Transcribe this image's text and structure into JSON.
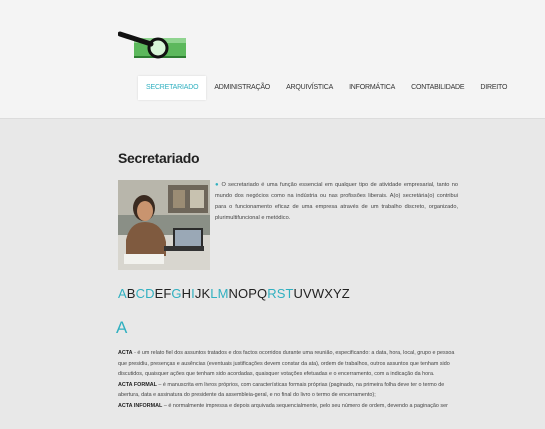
{
  "nav": {
    "items": [
      {
        "label": "SECRETARIADO",
        "active": true
      },
      {
        "label": "ADMINISTRAÇÃO",
        "active": false
      },
      {
        "label": "ARQUIVÍSTICA",
        "active": false
      },
      {
        "label": "INFORMÁTICA",
        "active": false
      },
      {
        "label": "CONTABILIDADE",
        "active": false
      },
      {
        "label": "DIREITO",
        "active": false
      }
    ]
  },
  "main": {
    "title": "Secretariado",
    "intro_text": "O secretariado é uma função essencial em qualquer tipo de atividade empresarial, tanto no mundo dos negócios como na indústria ou nas profissões liberais. A(o) secretária(o) contribui para o funcionamento eficaz de uma empresa através de um trabalho discreto, organizado, plurimultifuncional e metódico."
  },
  "alphabet": [
    {
      "letter": "A",
      "highlight": true
    },
    {
      "letter": "B",
      "highlight": false
    },
    {
      "letter": "C",
      "highlight": true
    },
    {
      "letter": "D",
      "highlight": true
    },
    {
      "letter": "E",
      "highlight": false
    },
    {
      "letter": "F",
      "highlight": false
    },
    {
      "letter": "G",
      "highlight": true
    },
    {
      "letter": "H",
      "highlight": false
    },
    {
      "letter": "I",
      "highlight": true
    },
    {
      "letter": "J",
      "highlight": false
    },
    {
      "letter": "K",
      "highlight": false
    },
    {
      "letter": "L",
      "highlight": true
    },
    {
      "letter": "M",
      "highlight": true
    },
    {
      "letter": "N",
      "highlight": false
    },
    {
      "letter": "O",
      "highlight": false
    },
    {
      "letter": "P",
      "highlight": false
    },
    {
      "letter": "Q",
      "highlight": false
    },
    {
      "letter": "R",
      "highlight": true
    },
    {
      "letter": "S",
      "highlight": true
    },
    {
      "letter": "T",
      "highlight": true
    },
    {
      "letter": "U",
      "highlight": false
    },
    {
      "letter": "V",
      "highlight": false
    },
    {
      "letter": "W",
      "highlight": false
    },
    {
      "letter": "X",
      "highlight": false
    },
    {
      "letter": "Y",
      "highlight": false
    },
    {
      "letter": "Z",
      "highlight": false
    }
  ],
  "section": {
    "letter": "A",
    "entries": [
      {
        "term": "ACTA",
        "text": " - é um relato fiel dos assuntos tratados e dos factos ocorridos durante uma reunião, especificando: a data, hora, local, grupo e pessoa que presidiu, presenças e ausências (eventuais justificações devem constar da ata), ordem de trabalhos, outros assuntos que tenham sido discutidos, quaisquer ações que tenham sido acordadas, quaisquer votações efetuadas e o encerramento, com a indicação da hora."
      },
      {
        "term": "ACTA FORMAL",
        "text": " – é manuscrita em livros próprios, com características formais próprias (paginado, na primeira folha deve ter o termo de abertura, data e assinatura do presidente da assembleia-geral, e no final do livro o termo de encerramento);"
      },
      {
        "term": "ACTA INFORMAL",
        "text": " – é normalmente impressa e depois arquivada sequencialmente, pelo seu número de ordem, devendo a paginação ser"
      }
    ]
  },
  "colors": {
    "accent": "#30b0c0",
    "logo_green": "#4caf50",
    "background": "#e8e8e8"
  },
  "icons": {
    "logo": "magnifier-logo-icon",
    "photo": "secretary-at-desk-photo"
  }
}
